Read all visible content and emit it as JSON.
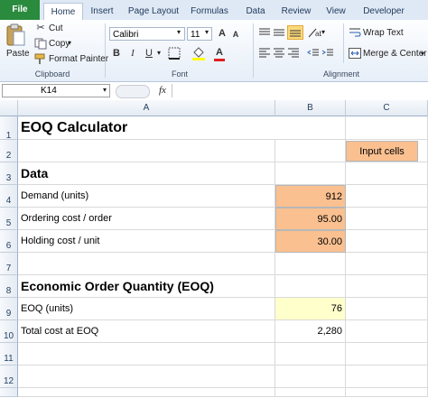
{
  "ribbon": {
    "tabs": [
      "File",
      "Home",
      "Insert",
      "Page Layout",
      "Formulas",
      "Data",
      "Review",
      "View",
      "Developer"
    ],
    "active_tab": "Home",
    "clipboard": {
      "paste": "Paste",
      "cut": "Cut",
      "copy": "Copy",
      "format_painter": "Format Painter",
      "label": "Clipboard"
    },
    "font": {
      "name": "Calibri",
      "size": "11",
      "label": "Font",
      "bold": "B",
      "italic": "I",
      "underline": "U"
    },
    "alignment": {
      "wrap_text": "Wrap Text",
      "merge_center": "Merge & Center",
      "label": "Alignment"
    }
  },
  "formula_bar": {
    "name_box": "K14",
    "fx": "fx",
    "formula": ""
  },
  "columns": [
    "A",
    "B",
    "C"
  ],
  "rows": [
    "1",
    "2",
    "3",
    "4",
    "5",
    "6",
    "7",
    "8",
    "9",
    "10",
    "11",
    "12"
  ],
  "sheet": {
    "title": "EOQ Calculator",
    "input_legend": "Input cells",
    "data_heading": "Data",
    "demand_label": "Demand (units)",
    "demand_value": "912",
    "ordering_label": "Ordering cost / order",
    "ordering_value": "95.00",
    "holding_label": "Holding cost / unit",
    "holding_value": "30.00",
    "eoq_heading": "Economic Order Quantity (EOQ)",
    "eoq_label": "EOQ (units)",
    "eoq_value": "76",
    "total_label": "Total cost at EOQ",
    "total_value": "2,280"
  },
  "colors": {
    "input_fill": "#fac090",
    "output_fill": "#ffffcc",
    "file_tab": "#2a8a3e"
  }
}
